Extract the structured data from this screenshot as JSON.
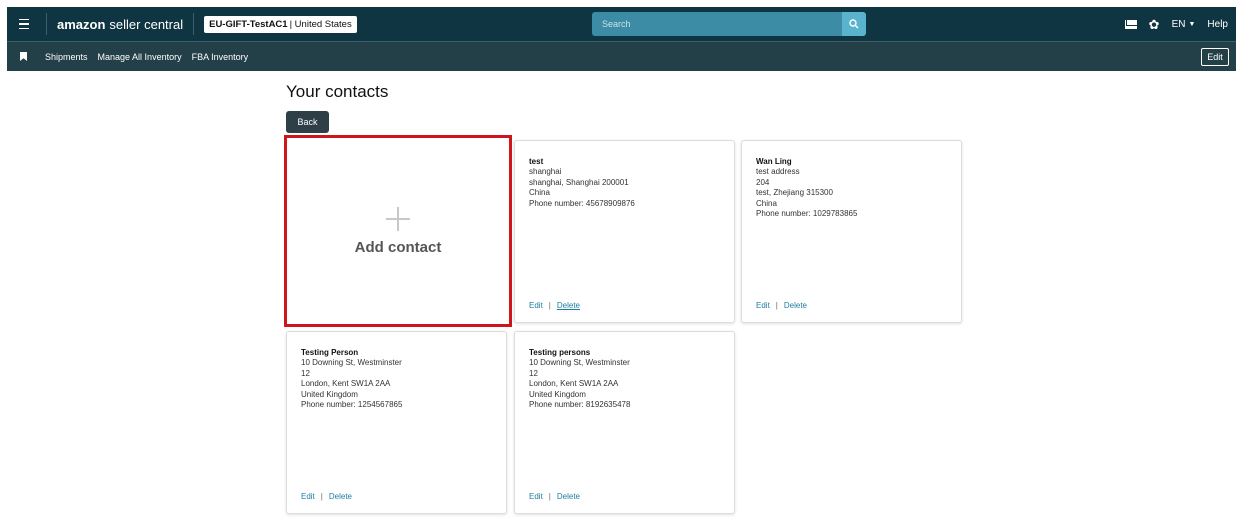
{
  "header": {
    "logo_bold": "amazon",
    "logo_rest": "seller central",
    "store_code": "EU-GIFT-TestAC1",
    "store_region": "| United States",
    "search_placeholder": "Search",
    "language": "EN",
    "help": "Help"
  },
  "nav": {
    "items": [
      "Shipments",
      "Manage All Inventory",
      "FBA Inventory"
    ],
    "edit": "Edit"
  },
  "page": {
    "title": "Your contacts",
    "back": "Back",
    "add_contact": "Add contact"
  },
  "contacts": [
    {
      "name": "test",
      "lines": [
        "shanghai",
        "shanghai, Shanghai 200001",
        "China",
        "Phone number: 45678909876"
      ],
      "edit": "Edit",
      "sep": "|",
      "delete": "Delete"
    },
    {
      "name": "Wan Ling",
      "lines": [
        "test address",
        "204",
        "test, Zhejiang 315300",
        "China",
        "Phone number: 1029783865"
      ],
      "edit": "Edit",
      "sep": "|",
      "delete": "Delete"
    },
    {
      "name": "Testing Person",
      "lines": [
        "10 Downing St, Westminster",
        "12",
        "London, Kent SW1A 2AA",
        "United Kingdom",
        "Phone number: 1254567865"
      ],
      "edit": "Edit",
      "sep": "|",
      "delete": "Delete"
    },
    {
      "name": "Testing persons",
      "lines": [
        "10 Downing St, Westminster",
        "12",
        "London, Kent SW1A 2AA",
        "United Kingdom",
        "Phone number: 8192635478"
      ],
      "edit": "Edit",
      "sep": "|",
      "delete": "Delete"
    }
  ]
}
